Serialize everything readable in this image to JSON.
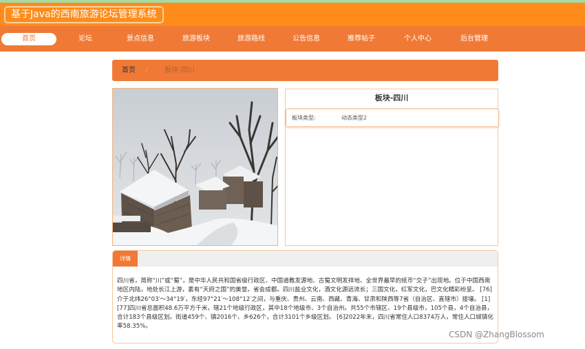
{
  "header": {
    "title": "基于Java的西南旅游论坛管理系统"
  },
  "nav": {
    "items": [
      {
        "label": "首页",
        "active": true
      },
      {
        "label": "论坛"
      },
      {
        "label": "景点信息"
      },
      {
        "label": "旅游板块"
      },
      {
        "label": "旅游路线"
      },
      {
        "label": "公告信息"
      },
      {
        "label": "推荐帖子"
      },
      {
        "label": "个人中心"
      },
      {
        "label": "后台管理"
      }
    ]
  },
  "breadcrumb": {
    "home": "首页",
    "separator": "/",
    "current": "板块-四川"
  },
  "info": {
    "title": "板块-四川",
    "type_label": "板块类型:",
    "type_value": "动态类型2"
  },
  "detail": {
    "tab_label": "详情",
    "text": "四川省，简称“川”或“蜀”，是中华人民共和国省级行政区、中国道教发源地、古蜀文明发祥地、全世界最早的纸币“交子”出现地。位于中国西南地区内陆，地处长江上游，素有“天府之国”的美誉。省会成都。四川盐业文化，酒文化源远流长；三国文化，红军文化，巴文化精彩纷呈。 [76]介于北纬26°03′～34°19′，东经97°21′～108°12′之间，与重庆、贵州、云南、西藏、青海、甘肃和陕西等7省（自治区、直辖市）接壤。 [1] [77]四川省总面积48.6万平方千米，辖21个地级行政区，其中18个地级市、3个自治州。共55个市辖区、19个县级市，105个县，4个自治县，合计183个县级区划。街道459个、镇2016个、乡626个，合计3101个乡级区划。 [6]2022年末，四川省常住人口8374万人，常住人口城镇化率58.35%。"
  },
  "watermark": "CSDN @ZhangBlossom",
  "colors": {
    "header": "#ff8c1a",
    "nav": "#f07a35",
    "accent": "#f07a35"
  }
}
